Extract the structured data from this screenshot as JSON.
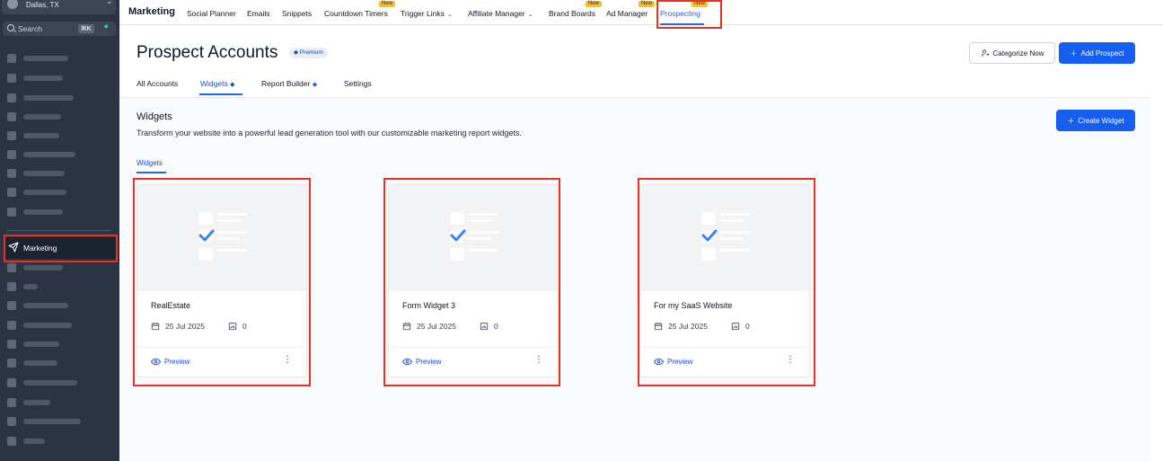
{
  "sidebar": {
    "location_line": "Dallas, TX",
    "search_placeholder": "Search",
    "search_shortcut": "⌘K",
    "marketing_label": "Marketing"
  },
  "topnav": {
    "title": "Marketing",
    "items": [
      {
        "label": "Social Planner"
      },
      {
        "label": "Emails"
      },
      {
        "label": "Snippets"
      },
      {
        "label": "Countdown Timers",
        "badge": "New"
      },
      {
        "label": "Trigger Links"
      },
      {
        "label": "Affiliate Manager"
      },
      {
        "label": "Brand Boards",
        "badge": "New"
      },
      {
        "label": "Ad Manager",
        "badge": "New"
      },
      {
        "label": "Prospecting",
        "badge": "New"
      }
    ]
  },
  "page": {
    "title": "Prospect Accounts",
    "premium_badge": "Premium",
    "categorize_button": "Categorize Now",
    "add_prospect_button": "Add Prospect",
    "tabs": [
      "All Accounts",
      "Widgets",
      "Report Builder",
      "Settings"
    ],
    "active_tab": "Widgets"
  },
  "section": {
    "title": "Widgets",
    "description": "Transform your website into a powerful lead generation tool with our customizable marketing report widgets.",
    "create_button": "Create Widget",
    "subtab": "Widgets"
  },
  "widgets": [
    {
      "name": "RealEstate",
      "date": "25 Jul 2025",
      "count": "0",
      "preview": "Preview"
    },
    {
      "name": "Form Widget 3",
      "date": "25 Jul 2025",
      "count": "0",
      "preview": "Preview"
    },
    {
      "name": "For my SaaS Website",
      "date": "25 Jul 2025",
      "count": "0",
      "preview": "Preview"
    }
  ],
  "colors": {
    "primary": "#155eef",
    "sidebar_bg": "#2c3444",
    "badge_new": "#fbbf24",
    "highlight": "#e53222"
  }
}
